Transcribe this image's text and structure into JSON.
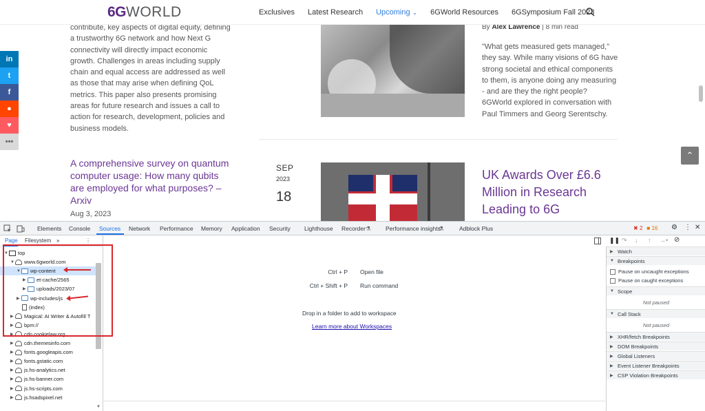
{
  "site": {
    "logo_prefix": "6G",
    "logo_suffix": "WORLD",
    "nav": [
      {
        "label": "Exclusives"
      },
      {
        "label": "Latest Research"
      },
      {
        "label": "Upcoming"
      },
      {
        "label": "6GWorld Resources"
      },
      {
        "label": "6GSymposium Fall 2023"
      }
    ],
    "left_paragraph": "contribute, key aspects of digital equity, defining a trustworthy 6G network and how Next G connectivity will directly impact economic growth. Challenges in areas including supply chain and equal access are addressed as well as those that may arise when defining QoL metrics. This paper also presents promising areas for future research and issues a call to action for research, development, policies and business models.",
    "survey_title": "A comprehensive survey on quantum computer usage: How many qubits are employed for what purposes? – Arxiv",
    "survey_date": "Aug 3, 2023",
    "author_prefix": "By",
    "author_name": "Alex Lawrence",
    "author_suffix": "| 8 min read",
    "right_paragraph": "\"What gets measured gets managed,\" they say. While many visions of 6G have strong societal and ethical components to them, is anyone doing any measuring - and are they the right people? 6GWorld explored in conversation with Paul Timmers and Georg Serentschy.",
    "date_month": "SEP",
    "date_year": "2023",
    "date_day": "18",
    "uk_title": "UK Awards Over £6.6 Million in Research Leading to 6G",
    "social": [
      {
        "icon": "linkedin-icon",
        "glyph": "in",
        "color": "#0077b5"
      },
      {
        "icon": "twitter-icon",
        "glyph": "t",
        "color": "#1da1f2"
      },
      {
        "icon": "facebook-icon",
        "glyph": "f",
        "color": "#3b5998"
      },
      {
        "icon": "reddit-icon",
        "glyph": "●",
        "color": "#ff4500"
      },
      {
        "icon": "heart-icon",
        "glyph": "♥",
        "color": "#ff5a5f"
      },
      {
        "icon": "more-icon",
        "glyph": "•••",
        "color": "#d9d9d9"
      }
    ],
    "scroll_top_glyph": "⌃"
  },
  "devtools": {
    "tabs": [
      "Elements",
      "Console",
      "Sources",
      "Network",
      "Performance",
      "Memory",
      "Application",
      "Security",
      "Lighthouse",
      "Recorder",
      "Performance insights",
      "Adblock Plus"
    ],
    "active_tab": "Sources",
    "error_count": "2",
    "warning_count": "16",
    "subtabs": [
      "Page",
      "Filesystem"
    ],
    "subtab_more": "»",
    "tree": [
      {
        "label": "top",
        "type": "frame",
        "indent": 0,
        "arrow": "▼"
      },
      {
        "label": "www.6gworld.com",
        "type": "cloud",
        "indent": 1,
        "arrow": "▼"
      },
      {
        "label": "wp-content",
        "type": "folder",
        "indent": 2,
        "arrow": "▼",
        "selected": true
      },
      {
        "label": "et-cache/2565",
        "type": "folder",
        "indent": 3,
        "arrow": "▶"
      },
      {
        "label": "uploads/2023/07",
        "type": "folder",
        "indent": 3,
        "arrow": "▶"
      },
      {
        "label": "wp-includes/js",
        "type": "folder",
        "indent": 2,
        "arrow": "▶"
      },
      {
        "label": "(index)",
        "type": "file",
        "indent": 2,
        "arrow": ""
      },
      {
        "label": "Magical: AI Writer & Autofill T",
        "type": "cloud",
        "indent": 1,
        "arrow": "▶"
      },
      {
        "label": "bpm://",
        "type": "cloud",
        "indent": 1,
        "arrow": "▶"
      },
      {
        "label": "cdn.cookielaw.org",
        "type": "cloud",
        "indent": 1,
        "arrow": "▶"
      },
      {
        "label": "cdn.themesinfo.com",
        "type": "cloud",
        "indent": 1,
        "arrow": "▶"
      },
      {
        "label": "fonts.googleapis.com",
        "type": "cloud",
        "indent": 1,
        "arrow": "▶"
      },
      {
        "label": "fonts.gstatic.com",
        "type": "cloud",
        "indent": 1,
        "arrow": "▶"
      },
      {
        "label": "js.hs-analytics.net",
        "type": "cloud",
        "indent": 1,
        "arrow": "▶"
      },
      {
        "label": "js.hs-banner.com",
        "type": "cloud",
        "indent": 1,
        "arrow": "▶"
      },
      {
        "label": "js.hs-scripts.com",
        "type": "cloud",
        "indent": 1,
        "arrow": "▶"
      },
      {
        "label": "js.hsadspixel.net",
        "type": "cloud",
        "indent": 1,
        "arrow": "▶"
      }
    ],
    "shortcuts": [
      {
        "key": "Ctrl + P",
        "label": "Open file"
      },
      {
        "key": "Ctrl + Shift + P",
        "label": "Run command"
      }
    ],
    "drop_text": "Drop in a folder to add to workspace",
    "learn_link": "Learn more about Workspaces",
    "debugger_sections": {
      "watch": "Watch",
      "breakpoints": "Breakpoints",
      "pause_uncaught": "Pause on uncaught exceptions",
      "pause_caught": "Pause on caught exceptions",
      "scope": "Scope",
      "not_paused": "Not paused",
      "call_stack": "Call Stack",
      "xhr": "XHR/fetch Breakpoints",
      "dom": "DOM Breakpoints",
      "global": "Global Listeners",
      "event": "Event Listener Breakpoints",
      "csp": "CSP Violation Breakpoints"
    }
  }
}
